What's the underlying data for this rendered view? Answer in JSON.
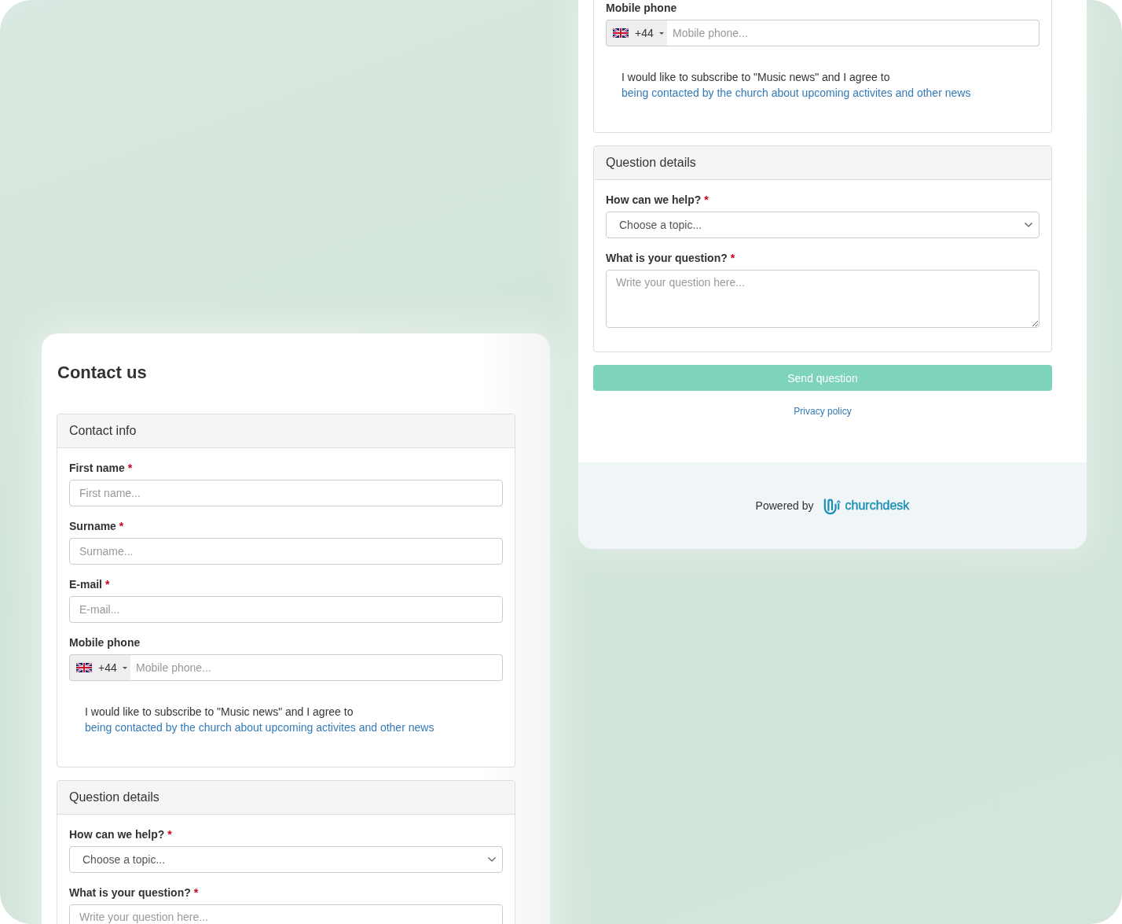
{
  "screens": [
    {
      "sections": [
        {
          "fields": [
            {
              "kind": "phone",
              "label": "Mobile phone",
              "country_code": "+44",
              "placeholder": "Mobile phone..."
            },
            {
              "kind": "consent",
              "text": "I would like to subscribe to \"Music news\" and I agree to",
              "link": "being contacted by the church about upcoming activites and other news"
            }
          ]
        },
        {
          "header": "Question details",
          "fields": [
            {
              "kind": "select",
              "label": "How can we help?",
              "required_mark": "*",
              "selected_option": "Choose a topic..."
            },
            {
              "kind": "textarea",
              "label": "What is your question?",
              "required_mark": "*",
              "placeholder": "Write your question here..."
            }
          ]
        }
      ],
      "submit_button": "Send question",
      "privacy_link": "Privacy policy",
      "footer": {
        "powered_by": "Powered by",
        "logo_text": "churchdesk"
      }
    },
    {
      "title": "Contact us",
      "sections": [
        {
          "header": "Contact info",
          "fields": [
            {
              "kind": "text",
              "label": "First name",
              "required_mark": "*",
              "placeholder": "First name..."
            },
            {
              "kind": "text",
              "label": "Surname",
              "required_mark": "*",
              "placeholder": "Surname..."
            },
            {
              "kind": "text",
              "label": "E-mail",
              "required_mark": "*",
              "placeholder": "E-mail..."
            },
            {
              "kind": "phone",
              "label": "Mobile phone",
              "country_code": "+44",
              "placeholder": "Mobile phone..."
            },
            {
              "kind": "consent",
              "text": "I would like to subscribe to \"Music news\" and I agree to",
              "link": "being contacted by the church about upcoming activites and other news"
            }
          ]
        },
        {
          "header": "Question details",
          "fields": [
            {
              "kind": "select",
              "label": "How can we help?",
              "required_mark": "*",
              "selected_option": "Choose a topic..."
            },
            {
              "kind": "textarea",
              "label": "What is your question?",
              "required_mark": "*",
              "placeholder": "Write your question here..."
            }
          ]
        }
      ]
    }
  ]
}
